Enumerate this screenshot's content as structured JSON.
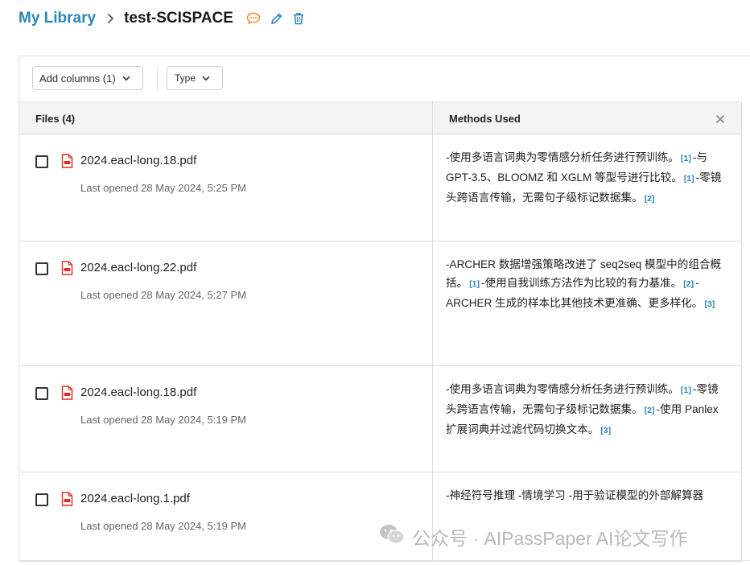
{
  "breadcrumb": {
    "library": "My Library",
    "title": "test-SCISPACE"
  },
  "colors": {
    "accent": "#2a86b6",
    "chat_icon": "#f08a28",
    "pdf_red": "#d93025"
  },
  "toolbar": {
    "add_columns_label": "Add columns (1)",
    "type_label": "Type"
  },
  "table": {
    "files_header": "Files (4)",
    "methods_header": "Methods Used",
    "rows": [
      {
        "filename": "2024.eacl-long.18.pdf",
        "date": "Last opened 28 May 2024, 5:25 PM",
        "methods": [
          {
            "t": "-使用多语言词典为零情感分析任务进行预训练。"
          },
          {
            "c": "[1]"
          },
          {
            "t": "-与 GPT-3.5、BLOOMZ 和 XGLM 等型号进行比较。"
          },
          {
            "c": "[1]"
          },
          {
            "t": "-零镜头跨语言传输，无需句子级标记数据集。"
          },
          {
            "c": "[2]"
          }
        ]
      },
      {
        "filename": "2024.eacl-long.22.pdf",
        "date": "Last opened 28 May 2024, 5:27 PM",
        "methods": [
          {
            "t": "-ARCHER 数据增强策略改进了 seq2seq 模型中的组合概括。"
          },
          {
            "c": "[1]"
          },
          {
            "t": "-使用自我训练方法作为比较的有力基准。"
          },
          {
            "c": "[2]"
          },
          {
            "t": "-ARCHER 生成的样本比其他技术更准确、更多样化。"
          },
          {
            "c": "[3]"
          }
        ]
      },
      {
        "filename": "2024.eacl-long.18.pdf",
        "date": "Last opened 28 May 2024, 5:19 PM",
        "methods": [
          {
            "t": "-使用多语言词典为零情感分析任务进行预训练。"
          },
          {
            "c": "[1]"
          },
          {
            "t": "-零镜头跨语言传输，无需句子级标记数据集。"
          },
          {
            "c": "[2]"
          },
          {
            "t": "-使用 Panlex 扩展词典并过滤代码切换文本。"
          },
          {
            "c": "[3]"
          }
        ]
      },
      {
        "filename": "2024.eacl-long.1.pdf",
        "date": "Last opened 28 May 2024, 5:19 PM",
        "methods": [
          {
            "t": "-神经符号推理 -情境学习 -用于验证模型的外部解算器"
          }
        ]
      }
    ]
  },
  "watermark": "公众号 · AIPassPaper AI论文写作"
}
